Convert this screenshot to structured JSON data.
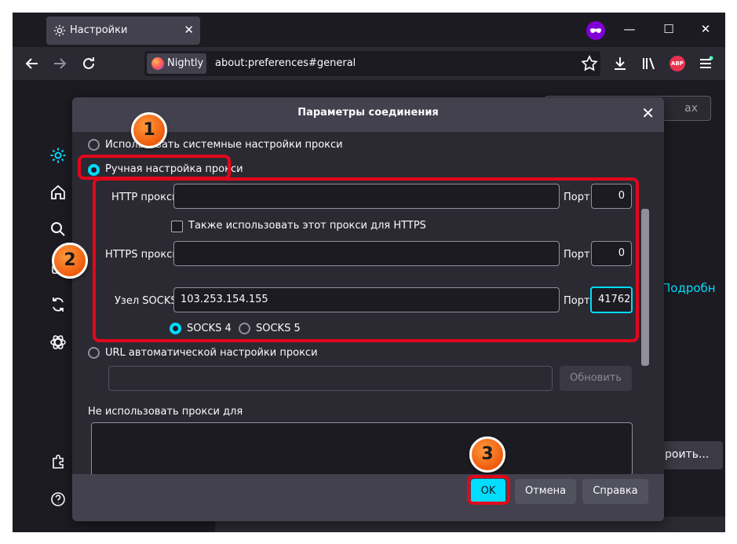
{
  "tab": {
    "title": "Настройки",
    "close_glyph": "✕"
  },
  "window_controls": {
    "minimize": "—",
    "maximize": "☐",
    "close": "✕"
  },
  "toolbar": {
    "back": "back-arrow",
    "forward": "forward-arrow",
    "reload": "reload",
    "browser_name": "Nightly",
    "url": "about:preferences#general",
    "abp_label": "ABP"
  },
  "background": {
    "search_placeholder": "ах",
    "link_text": "Подробн",
    "settings_button": "роить..."
  },
  "dialog": {
    "title": "Параметры соединения",
    "close_glyph": "✕",
    "options": {
      "system_proxy": "Использовать системные настройки прокси",
      "manual_proxy": "Ручная настройка прокси",
      "auto_url": "URL автоматической настройки прокси"
    },
    "http": {
      "label": "HTTP прокси",
      "value": "",
      "port_label": "Порт",
      "port": "0"
    },
    "also_https": "Также использовать этот прокси для HTTPS",
    "https": {
      "label": "HTTPS прокси",
      "value": "",
      "port_label": "Порт",
      "port": "0"
    },
    "socks": {
      "label": "Узел SOCKS",
      "value": "103.253.154.155",
      "port_label": "Порт",
      "port": "41762"
    },
    "socks4": "SOCKS 4",
    "socks5": "SOCKS 5",
    "auto_url_value": "",
    "reload_button": "Обновить",
    "no_proxy_label": "Не использовать прокси для",
    "no_proxy_value": "",
    "ok_button": "OK",
    "cancel_button": "Отмена",
    "help_button": "Справка"
  },
  "annotations": {
    "step1": "1",
    "step2": "2",
    "step3": "3",
    "color": "#e2071b"
  }
}
